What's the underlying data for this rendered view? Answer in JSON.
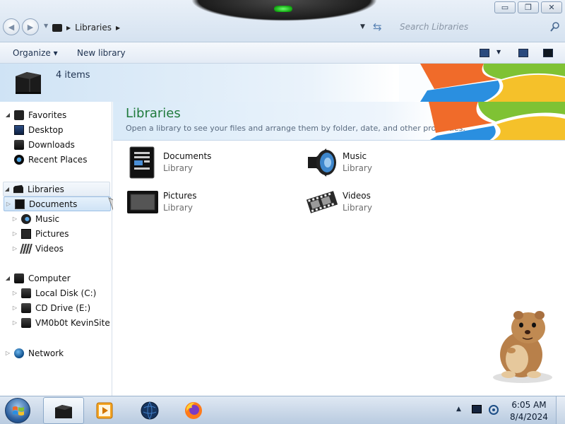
{
  "window": {
    "minimize_glyph": "▭",
    "maximize_glyph": "❐",
    "close_glyph": "✕"
  },
  "address": {
    "location": "Libraries",
    "search_placeholder": "Search Libraries"
  },
  "commands": {
    "organize": "Organize ▾",
    "new_library": "New library"
  },
  "details": {
    "item_count": "4 items"
  },
  "nav": {
    "favorites": {
      "label": "Favorites",
      "items": [
        "Desktop",
        "Downloads",
        "Recent Places"
      ]
    },
    "libraries": {
      "label": "Libraries",
      "items": [
        "Documents",
        "Music",
        "Pictures",
        "Videos"
      ],
      "selected": "Documents"
    },
    "computer": {
      "label": "Computer",
      "items": [
        "Local Disk (C:)",
        "CD Drive (E:)",
        "VM0b0t KevinSite"
      ]
    },
    "network": {
      "label": "Network"
    }
  },
  "content": {
    "title": "Libraries",
    "subtitle": "Open a library to see your files and arrange them by folder, date, and other properties.",
    "libraries": [
      {
        "name": "Documents",
        "type": "Library",
        "icon": "documents-library-icon"
      },
      {
        "name": "Music",
        "type": "Library",
        "icon": "music-library-icon"
      },
      {
        "name": "Pictures",
        "type": "Library",
        "icon": "pictures-library-icon"
      },
      {
        "name": "Videos",
        "type": "Library",
        "icon": "videos-library-icon"
      }
    ]
  },
  "taskbar": {
    "clock_time": "6:05 AM",
    "clock_date": "8/4/2024",
    "pinned": [
      "explorer-icon",
      "media-player-icon",
      "globe-icon",
      "firefox-icon"
    ]
  },
  "colors": {
    "accent_title": "#1f7a3c",
    "selection": "#cfe3f6"
  }
}
